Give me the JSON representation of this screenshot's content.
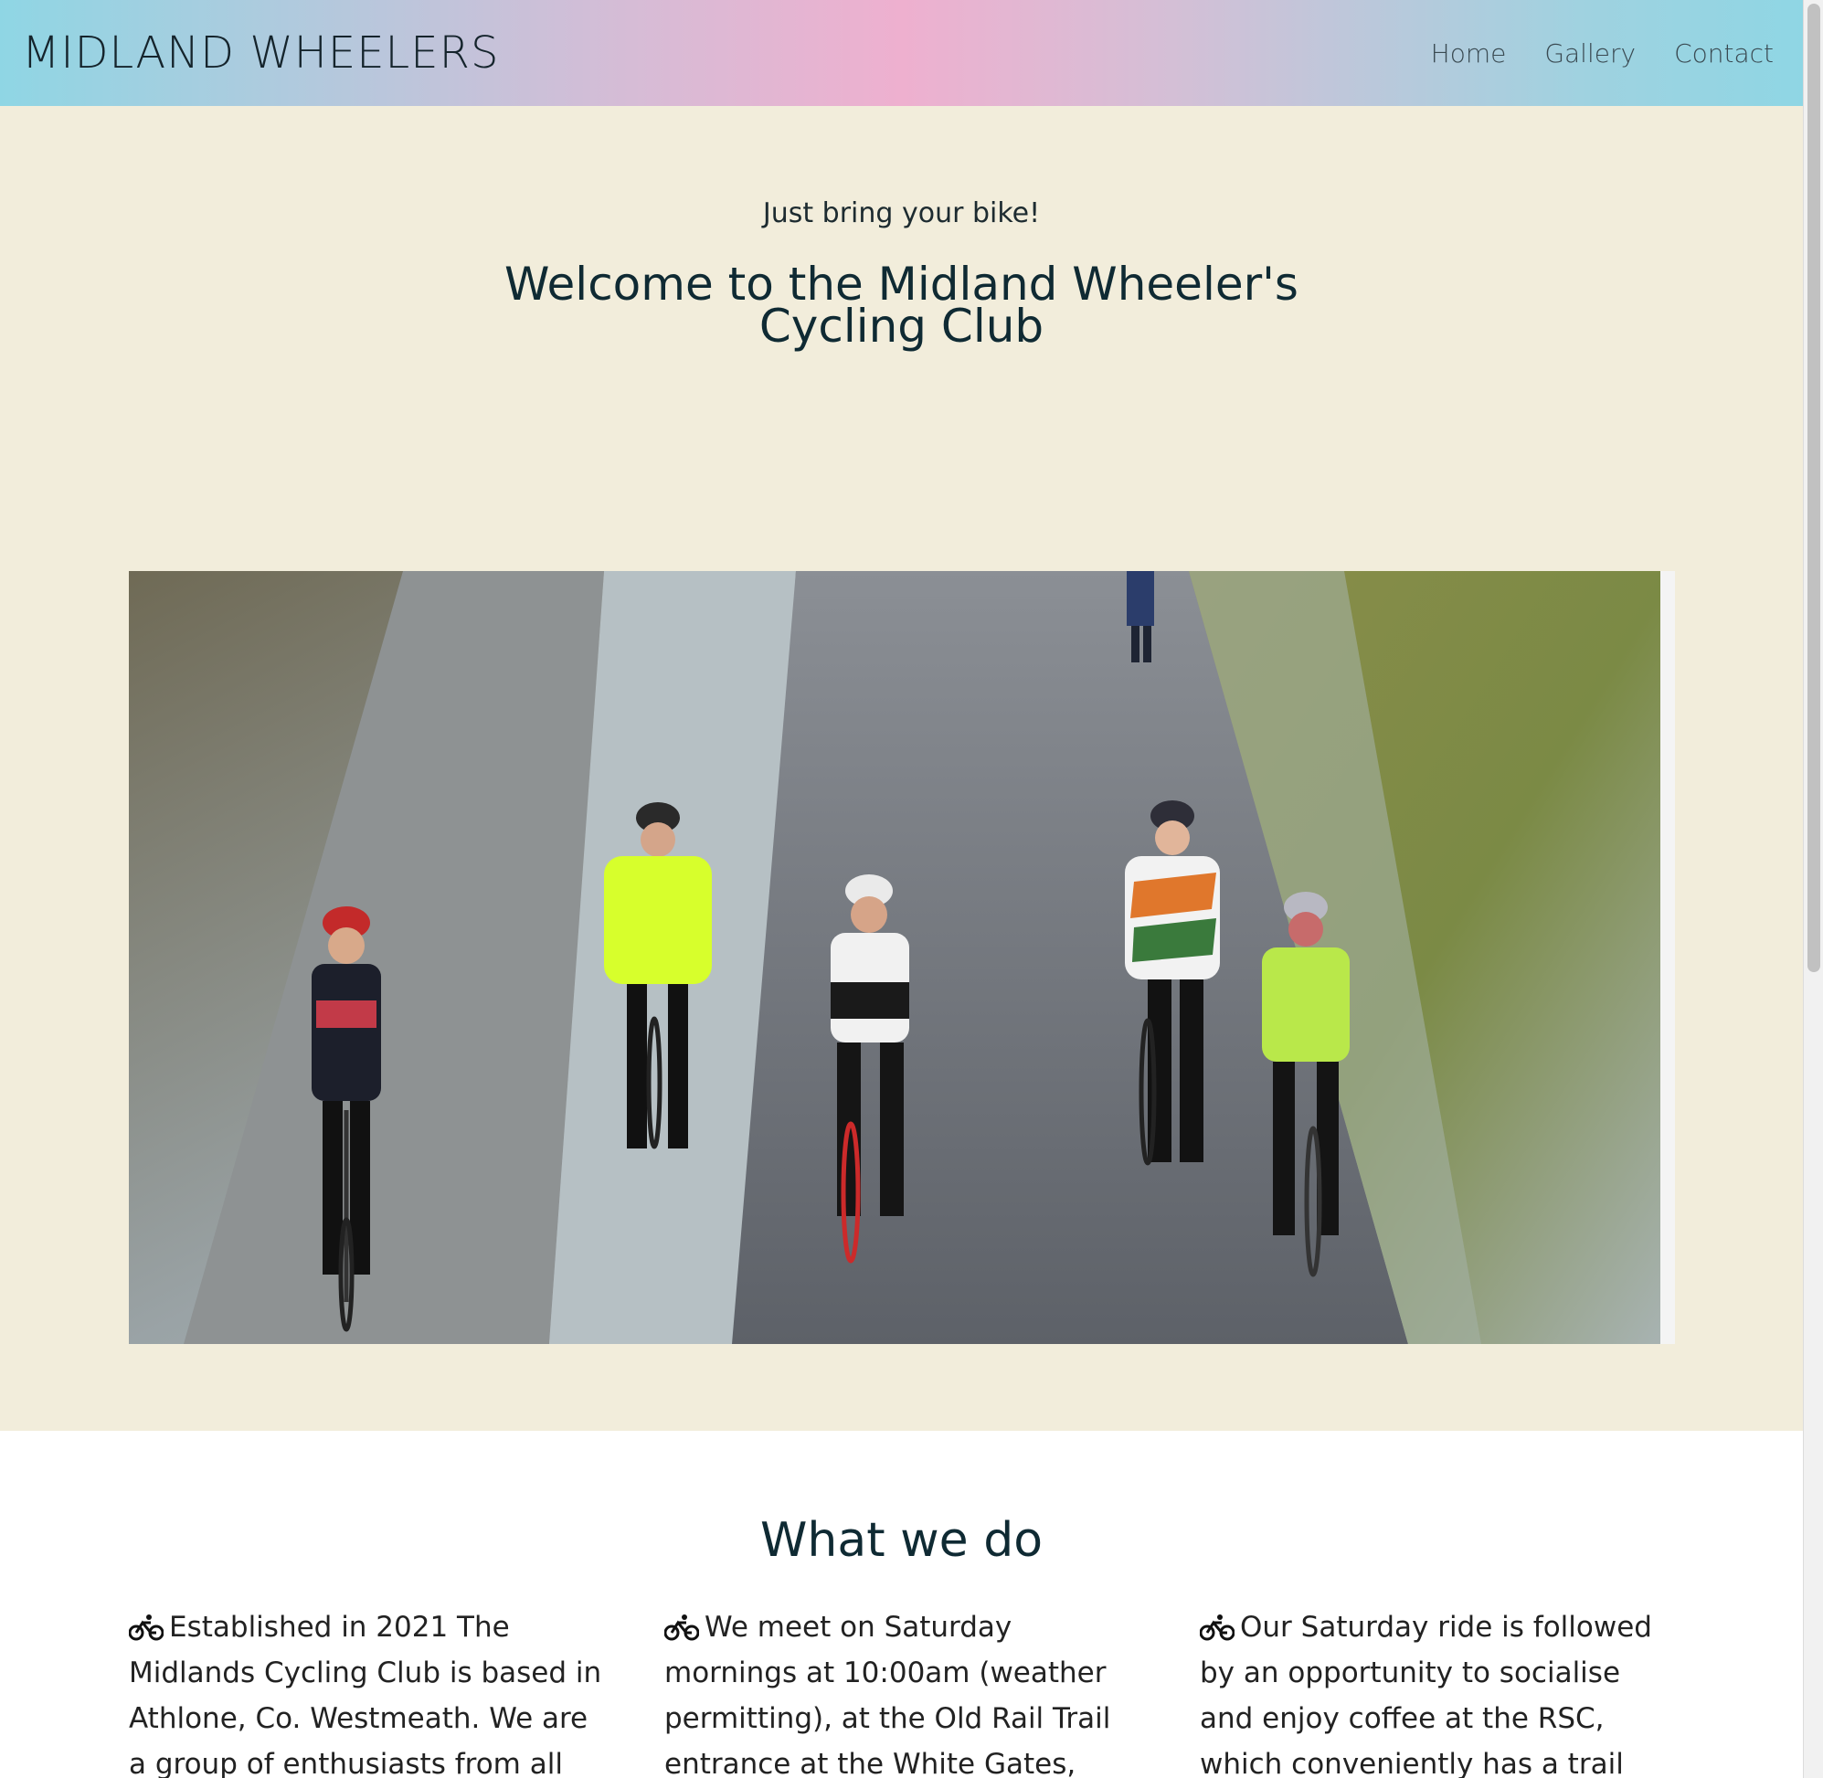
{
  "header": {
    "brand": "MIDLAND WHEELERS",
    "nav": [
      "Home",
      "Gallery",
      "Contact"
    ]
  },
  "hero": {
    "tagline": "Just bring your bike!",
    "title": "Welcome to the Midland Wheeler's Cycling Club",
    "photo_subject": "group-of-cyclists-on-trail"
  },
  "what_we_do": {
    "title": "What we do",
    "icon": "bicycle-icon",
    "columns": [
      "Established in 2021 The Midlands Cycling Club is based in Athlone, Co. Westmeath. We are a group of enthusiasts from all walks of life and",
      "We meet on Saturday mornings at 10:00am (weather permitting), at the Old Rail Trail entrance at the White Gates, and proceed along the newly-",
      "Our Saturday ride is followed by an opportunity to socialise and enjoy coffee at the RSC, which conveniently has a trail linking it to the greenway."
    ]
  },
  "colors": {
    "hero_bg": "#f2eddb",
    "heading": "#0f2a33",
    "header_gradient_start": "#8fd6e4",
    "header_gradient_mid": "#eeb0cf"
  }
}
